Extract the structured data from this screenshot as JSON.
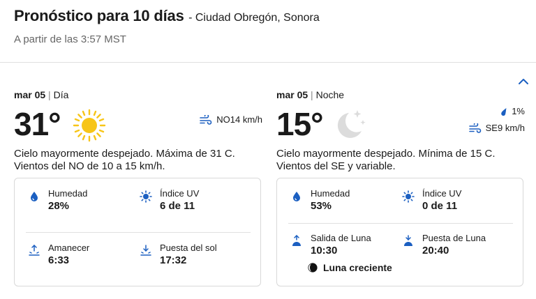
{
  "header": {
    "title": "Pronóstico para 10 días",
    "location": "- Ciudad Obregón, Sonora",
    "subtitle": "A partir de las 3:57 MST"
  },
  "day": {
    "date": "mar 05",
    "period": "Día",
    "temp": "31°",
    "icon": "sun-icon",
    "wind": "NO14 km/h",
    "description": "Cielo mayormente despejado. Máxima de 31 C. Vientos del NO de 10 a 15 km/h.",
    "humidity_label": "Humedad",
    "humidity": "28%",
    "uv_label": "Índice UV",
    "uv": "6 de 11",
    "sunrise_label": "Amanecer",
    "sunrise": "6:33",
    "sunset_label": "Puesta del sol",
    "sunset": "17:32"
  },
  "night": {
    "date": "mar 05",
    "period": "Noche",
    "temp": "15°",
    "icon": "moon-stars-icon",
    "precip": "1%",
    "wind": "SE9 km/h",
    "description": "Cielo mayormente despejado. Mínima de 15 C. Vientos del SE y variable.",
    "humidity_label": "Humedad",
    "humidity": "53%",
    "uv_label": "Índice UV",
    "uv": "0 de 11",
    "moonrise_label": "Salida de Luna",
    "moonrise": "10:30",
    "moonset_label": "Puesta de Luna",
    "moonset": "20:40",
    "moon_phase": "Luna creciente"
  },
  "colors": {
    "accent": "#1b5fc1",
    "sun": "#f7c518",
    "moon": "#d9d9d9"
  }
}
